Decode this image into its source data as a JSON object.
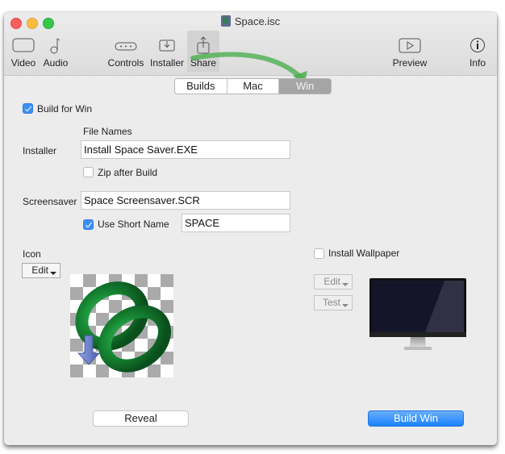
{
  "window": {
    "title": "Space.isc"
  },
  "toolbar": {
    "items": [
      {
        "label": "Video",
        "icon": "video-frame-icon"
      },
      {
        "label": "Audio",
        "icon": "music-note-icon"
      },
      {
        "label": "Controls",
        "icon": "controls-icon"
      },
      {
        "label": "Installer",
        "icon": "installer-download-icon"
      },
      {
        "label": "Share",
        "icon": "share-icon",
        "selected": true
      },
      {
        "label": "Preview",
        "icon": "play-icon"
      },
      {
        "label": "Info",
        "icon": "info-icon"
      }
    ]
  },
  "segments": {
    "items": [
      "Builds",
      "Mac",
      "Win"
    ],
    "selected": "Win"
  },
  "build_for_win": {
    "label": "Build for Win",
    "checked": true
  },
  "file_names": {
    "heading": "File Names",
    "installer_label": "Installer",
    "installer_value": "Install Space Saver.EXE",
    "zip_label": "Zip after Build",
    "zip_checked": false,
    "screensaver_label": "Screensaver",
    "screensaver_value": "Space Screensaver.SCR",
    "short_name_label": "Use Short Name",
    "short_name_checked": true,
    "short_name_value": "SPACE"
  },
  "icon_section": {
    "label": "Icon",
    "edit_label": "Edit"
  },
  "wallpaper": {
    "label": "Install Wallpaper",
    "checked": false,
    "edit_label": "Edit",
    "test_label": "Test"
  },
  "actions": {
    "reveal_label": "Reveal",
    "build_label": "Build Win"
  },
  "colors": {
    "accent": "#1a82fb",
    "annotation_arrow": "#4caf50"
  }
}
